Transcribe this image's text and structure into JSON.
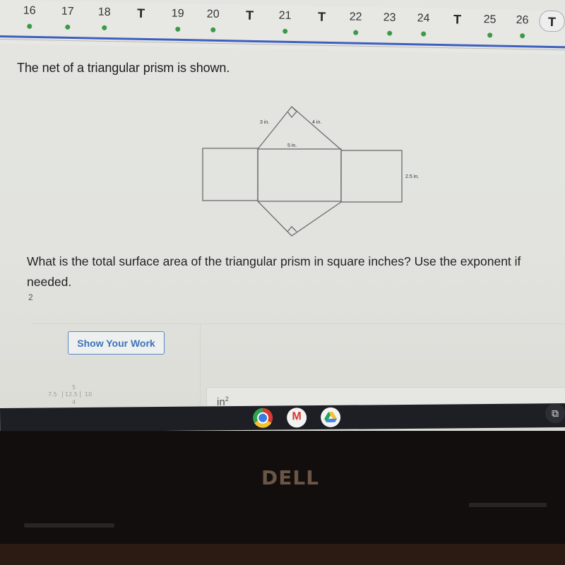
{
  "question_nav": {
    "items": [
      {
        "label": "16",
        "type": "question",
        "answered": true
      },
      {
        "label": "17",
        "type": "question",
        "answered": true
      },
      {
        "label": "18",
        "type": "question",
        "answered": true
      },
      {
        "label": "T",
        "type": "tool",
        "answered": false
      },
      {
        "label": "19",
        "type": "question",
        "answered": true
      },
      {
        "label": "20",
        "type": "question",
        "answered": true
      },
      {
        "label": "T",
        "type": "tool",
        "answered": false
      },
      {
        "label": "21",
        "type": "question",
        "answered": true
      },
      {
        "label": "T",
        "type": "tool",
        "answered": false
      },
      {
        "label": "22",
        "type": "question",
        "answered": true
      },
      {
        "label": "23",
        "type": "question",
        "answered": true
      },
      {
        "label": "24",
        "type": "question",
        "answered": true
      },
      {
        "label": "T",
        "type": "tool",
        "answered": false
      },
      {
        "label": "25",
        "type": "question",
        "answered": true
      },
      {
        "label": "26",
        "type": "question",
        "answered": true
      },
      {
        "label": "T",
        "type": "tool",
        "answered": false,
        "current": true
      }
    ],
    "answered_dot_color": "#3a9a48",
    "progress_line_color": "#3e5fc0"
  },
  "problem": {
    "intro": "The net of a triangular prism is shown.",
    "diagram": {
      "labels": {
        "leg_left": "3 in.",
        "leg_right": "4 in.",
        "hypotenuse": "5 in.",
        "height": "2.5 in."
      }
    },
    "question": "What is the total surface area of the triangular prism in square inches? Use the exponent if needed.",
    "hint": "2"
  },
  "answer": {
    "show_work_label": "Show Your Work",
    "scratch_work": [
      "5",
      "7.5",
      "12.5",
      "10",
      "4"
    ],
    "unit": "in",
    "unit_exponent": "2",
    "value": ""
  },
  "shelf": {
    "apps": [
      {
        "name": "Chrome",
        "icon": "chrome-icon"
      },
      {
        "name": "Gmail",
        "icon": "gmail-icon"
      },
      {
        "name": "Google Drive",
        "icon": "drive-icon"
      }
    ],
    "overview_glyph": "⧉"
  },
  "hardware": {
    "brand": "DELL"
  }
}
